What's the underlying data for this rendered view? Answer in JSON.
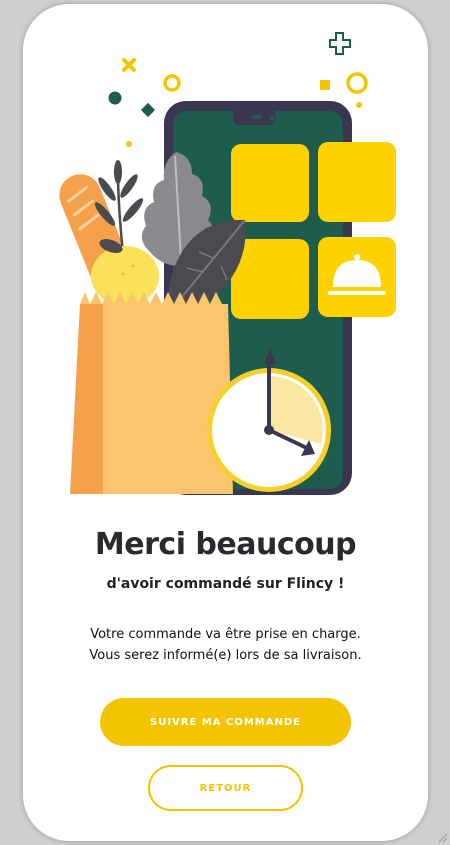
{
  "thanks": {
    "title": "Merci beaucoup",
    "subtitle": "d'avoir commandé sur Flincy !",
    "message_line1": "Votre commande va être prise en charge.",
    "message_line2": "Vous serez informé(e) lors de sa livraison."
  },
  "actions": {
    "track_label": "SUIVRE MA COMMANDE",
    "back_label": "RETOUR"
  },
  "colors": {
    "accent": "#f5c400",
    "phone_screen": "#1e5c4e",
    "text_dark": "#2a2a2e"
  },
  "icons": [
    "cloche-icon",
    "clock-icon",
    "grocery-bag-icon",
    "phone-icon"
  ]
}
